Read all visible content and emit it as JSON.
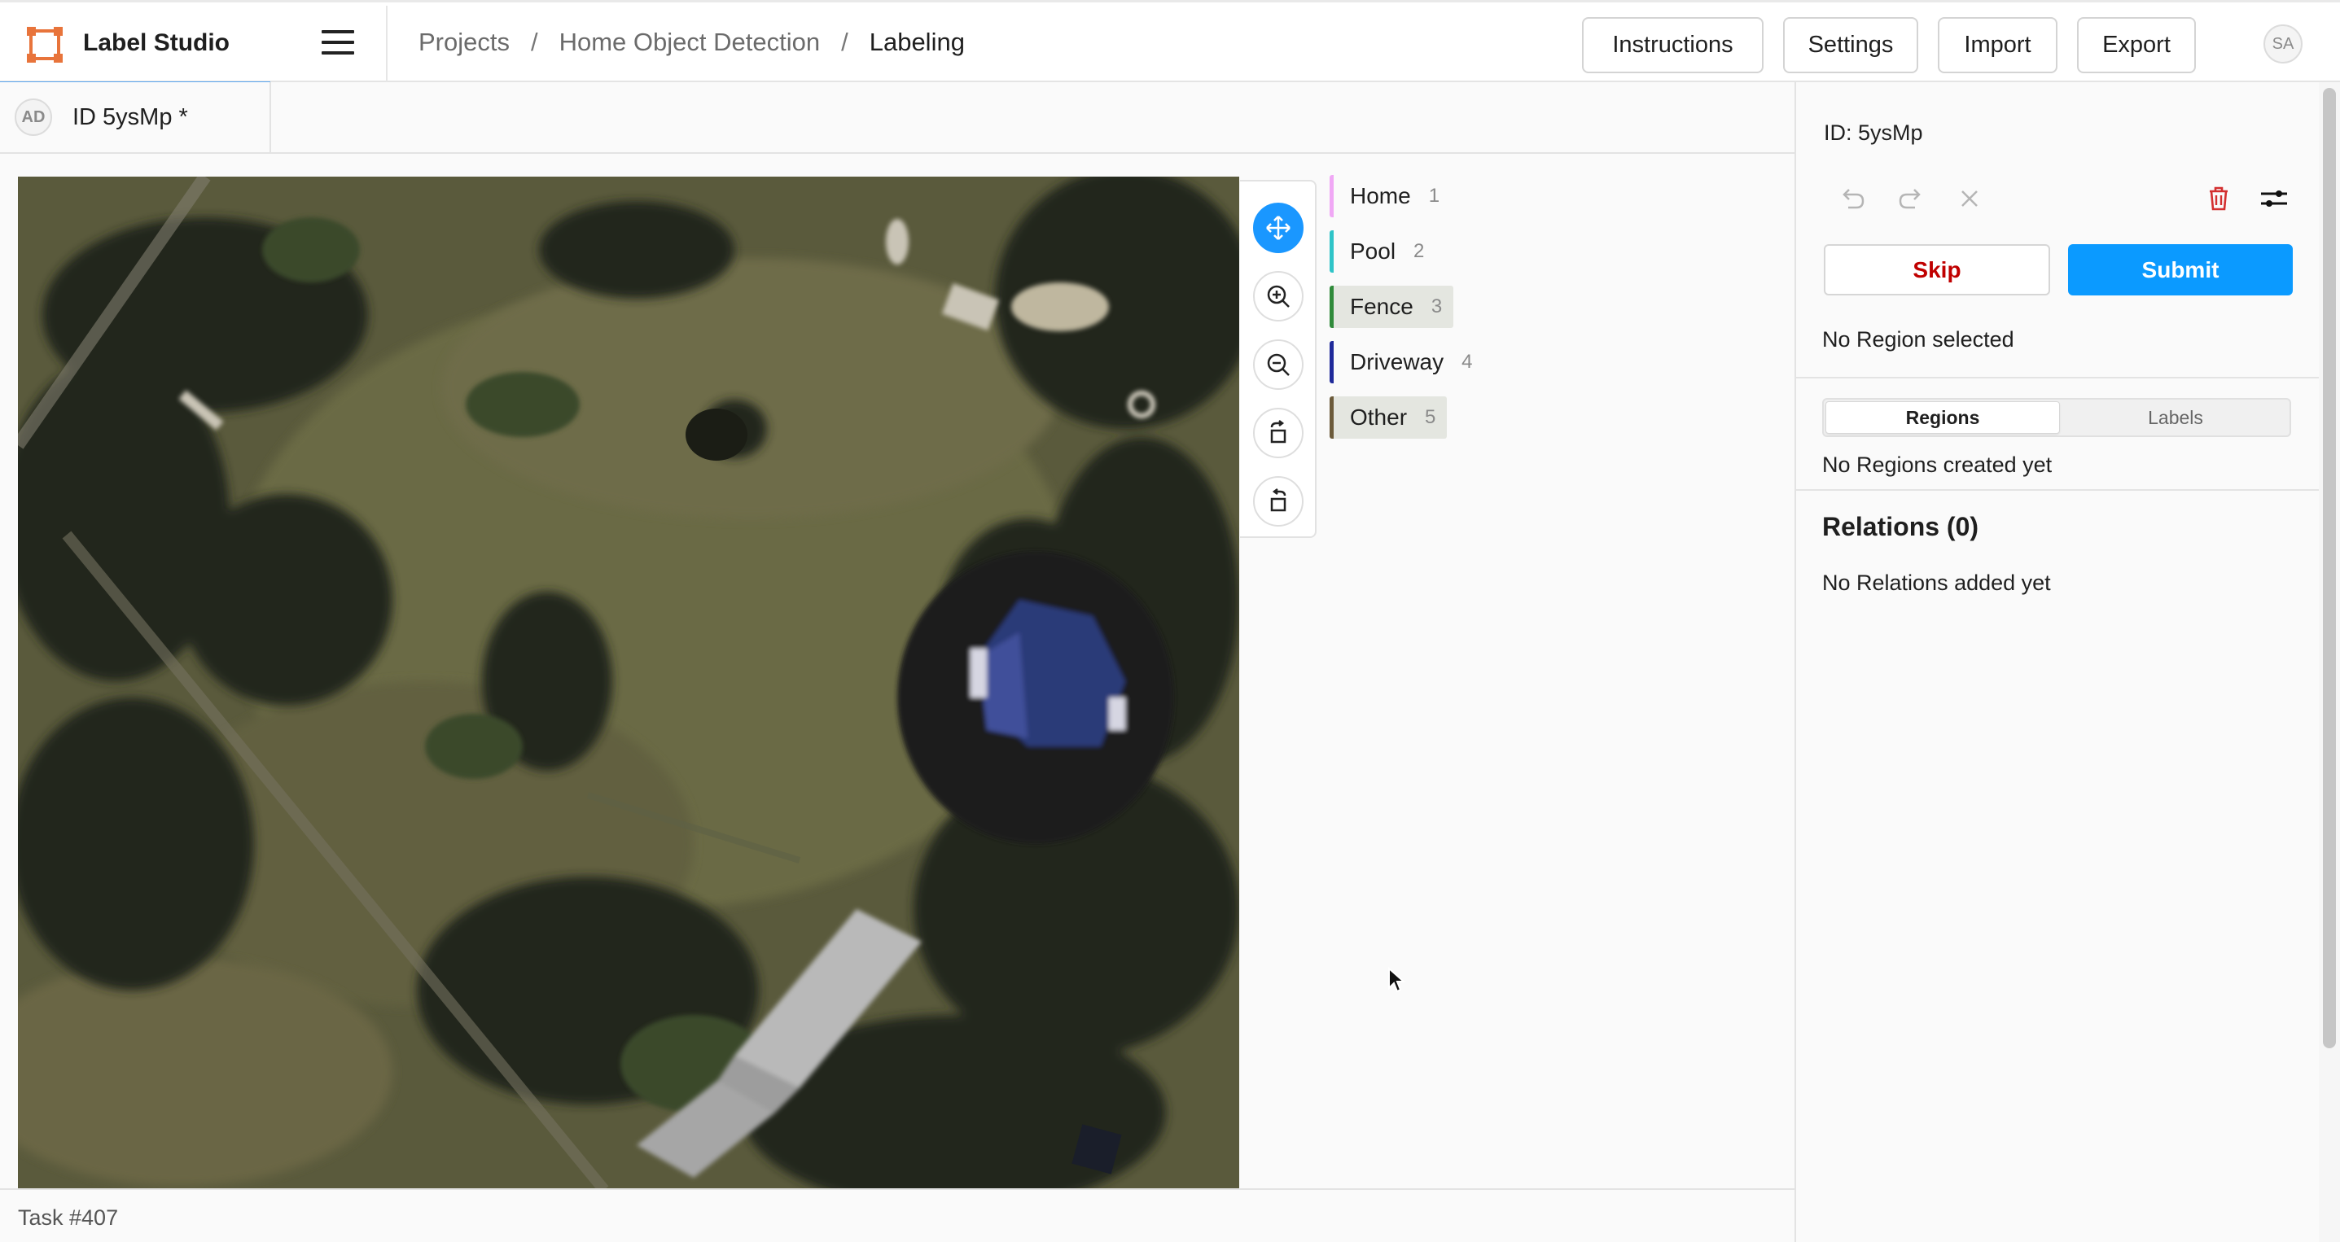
{
  "app": {
    "title": "Label Studio"
  },
  "breadcrumb": {
    "projects": "Projects",
    "separator": "/",
    "project": "Home Object Detection",
    "page": "Labeling"
  },
  "header_buttons": {
    "instructions": "Instructions",
    "settings": "Settings",
    "import": "Import",
    "export": "Export"
  },
  "user": {
    "initials": "SA"
  },
  "annotation_tab": {
    "avatar": "AD",
    "label": "ID 5ysMp *"
  },
  "tools": [
    "move-icon",
    "zoom-in-icon",
    "zoom-out-icon",
    "rotate-left-icon",
    "rotate-right-icon"
  ],
  "labels": [
    {
      "name": "Home",
      "hotkey": "1",
      "color": "#f0a8f5",
      "selected": false
    },
    {
      "name": "Pool",
      "hotkey": "2",
      "color": "#2fc4c8",
      "selected": false
    },
    {
      "name": "Fence",
      "hotkey": "3",
      "color": "#2f8a3a",
      "selected": true
    },
    {
      "name": "Driveway",
      "hotkey": "4",
      "color": "#1f2a9a",
      "selected": false
    },
    {
      "name": "Other",
      "hotkey": "5",
      "color": "#6b5a3a",
      "selected": true
    }
  ],
  "status": {
    "task": "Task #407"
  },
  "right_panel": {
    "id_label": "ID: 5ysMp",
    "skip": "Skip",
    "submit": "Submit",
    "no_region": "No Region selected",
    "tabs": {
      "regions": "Regions",
      "labels": "Labels"
    },
    "no_regions": "No Regions created yet",
    "relations_title": "Relations (0)",
    "no_relations": "No Relations added yet"
  },
  "colors": {
    "accent": "#0b9aff",
    "skip_text": "#c00000",
    "delete_icon": "#d32f2f",
    "logo": "#e8743b"
  }
}
